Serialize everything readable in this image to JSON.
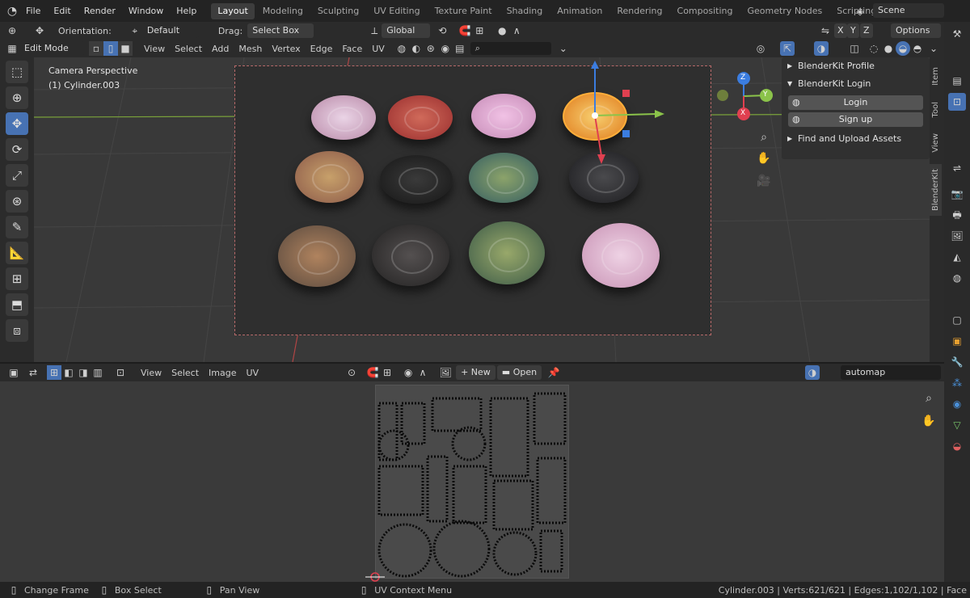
{
  "topbar": {
    "menus": [
      "File",
      "Edit",
      "Render",
      "Window",
      "Help"
    ],
    "workspaces": [
      "Layout",
      "Modeling",
      "Sculpting",
      "UV Editing",
      "Texture Paint",
      "Shading",
      "Animation",
      "Rendering",
      "Compositing",
      "Geometry Nodes",
      "Scripting"
    ],
    "active_workspace": "Layout",
    "scene_name": "Scene"
  },
  "tool_header": {
    "orientation_label": "Orientation:",
    "orientation_value": "Default",
    "drag_label": "Drag:",
    "drag_value": "Select Box",
    "transform_orientation": "Global",
    "axes": [
      "X",
      "Y",
      "Z"
    ],
    "options_label": "Options"
  },
  "view_header": {
    "mode": "Edit Mode",
    "menus": [
      "View",
      "Select",
      "Add",
      "Mesh",
      "Vertex",
      "Edge",
      "Face",
      "UV"
    ]
  },
  "viewport": {
    "camera_label": "Camera Perspective",
    "object_label": "(1) Cylinder.003",
    "gizmo_axes": {
      "x": "X",
      "y": "Y",
      "z": "Z"
    },
    "discs": [
      {
        "name": "disc-1",
        "color": "#c98fb0"
      },
      {
        "name": "disc-2",
        "color": "#b54040"
      },
      {
        "name": "disc-3",
        "color": "#d49ac4"
      },
      {
        "name": "disc-4",
        "color": "#e8a030"
      },
      {
        "name": "disc-5",
        "color": "#a86a50"
      },
      {
        "name": "disc-6",
        "color": "#262626"
      },
      {
        "name": "disc-7",
        "color": "#4d7a70"
      },
      {
        "name": "disc-8",
        "color": "#2e2e30"
      },
      {
        "name": "disc-9",
        "color": "#8a6a5a"
      },
      {
        "name": "disc-10",
        "color": "#3a3838"
      },
      {
        "name": "disc-11",
        "color": "#5c7a55"
      },
      {
        "name": "disc-12",
        "color": "#d8a8c0"
      }
    ]
  },
  "npanel": {
    "profile_label": "BlenderKit Profile",
    "login_section_label": "BlenderKit Login",
    "login_button": "Login",
    "signup_button": "Sign up",
    "find_assets_label": "Find and Upload Assets",
    "tabs": [
      "Item",
      "Tool",
      "View",
      "BlenderKit"
    ]
  },
  "uv_editor": {
    "menus": [
      "View",
      "Select",
      "Image",
      "UV"
    ],
    "new_button": "New",
    "open_button": "Open",
    "image_name": "automap"
  },
  "statusbar": {
    "change_frame": "Change Frame",
    "box_select": "Box Select",
    "pan_view": "Pan View",
    "uv_context_menu": "UV Context Menu",
    "stats": "Cylinder.003 | Verts:621/621 | Edges:1,102/1,102 | Face"
  },
  "colors": {
    "accent": "#4772b3",
    "x_axis": "#e04050",
    "y_axis": "#8bc34a",
    "z_axis": "#3b7de0"
  }
}
